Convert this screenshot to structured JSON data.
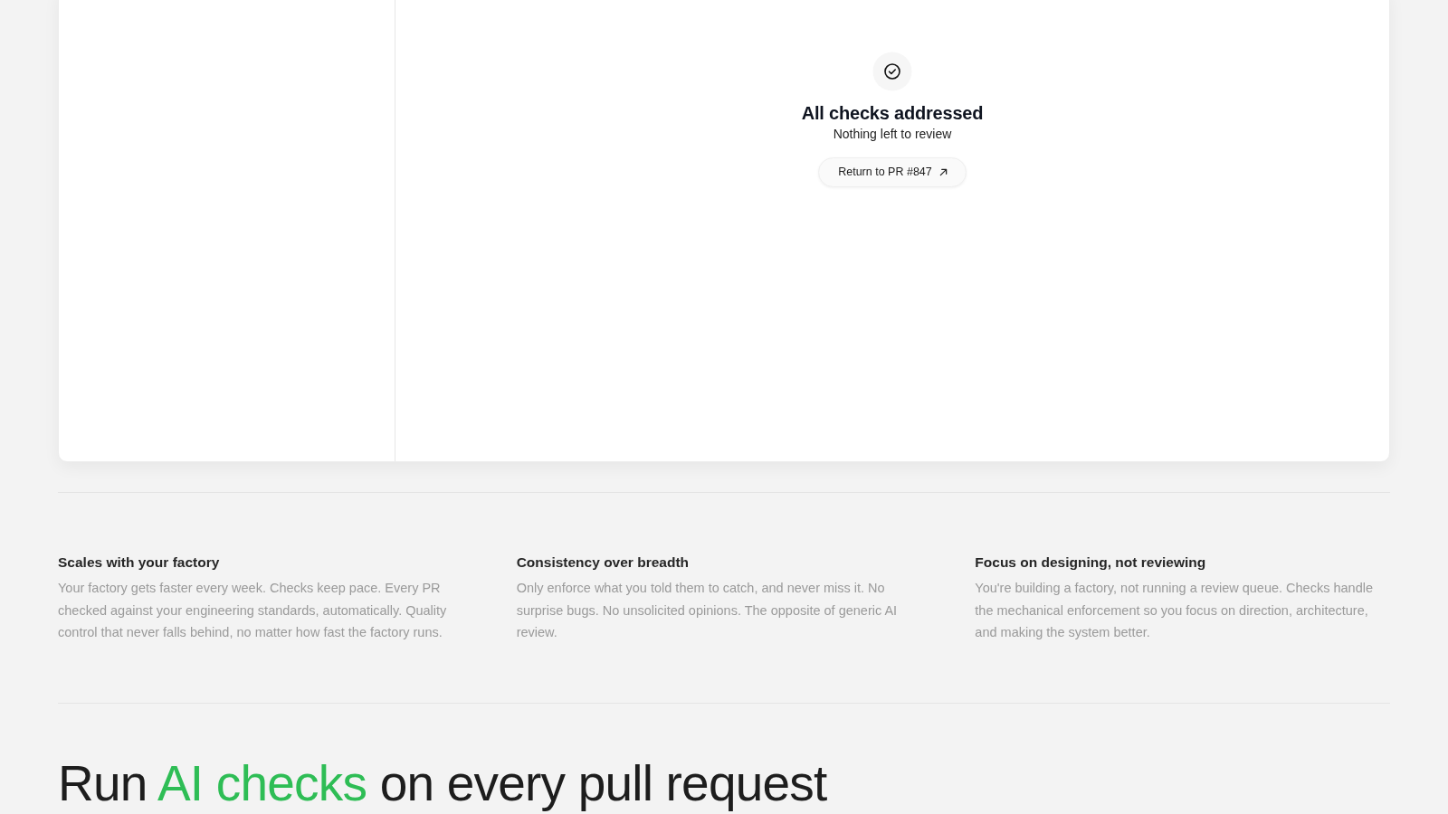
{
  "review_panel": {
    "empty_state": {
      "title": "All checks addressed",
      "subtitle": "Nothing left to review",
      "button": "Return to PR #847"
    }
  },
  "features": [
    {
      "title": "Scales with your factory",
      "body": "Your factory gets faster every week. Checks keep pace. Every PR checked against your engineering standards, automatically. Quality control that never falls behind, no matter how fast the factory runs."
    },
    {
      "title": "Consistency over breadth",
      "body": "Only enforce what you told them to catch, and never miss it. No surprise bugs. No unsolicited opinions. The opposite of generic AI review."
    },
    {
      "title": "Focus on designing, not reviewing",
      "body": "You're building a factory, not running a review queue. Checks handle the mechanical enforcement so you focus on direction, architecture, and making the system better."
    }
  ],
  "headline": {
    "parts": [
      {
        "text": "Run ",
        "accent": false
      },
      {
        "text": "AI checks",
        "accent": true
      },
      {
        "text": " on every pull request",
        "accent": false
      }
    ]
  }
}
